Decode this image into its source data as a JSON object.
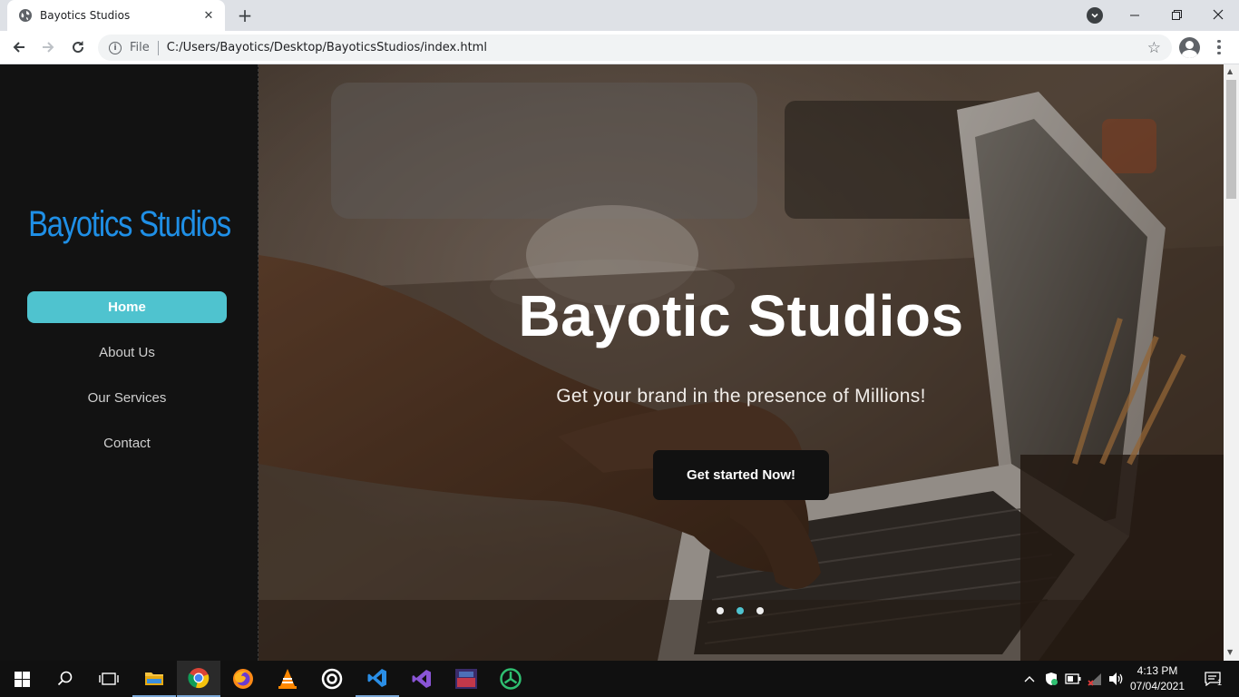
{
  "browser": {
    "tab_title": "Bayotics Studios",
    "scheme_label": "File",
    "url": "C:/Users/Bayotics/Desktop/BayoticsStudios/index.html"
  },
  "sidebar": {
    "logo": "Bayotics Studios",
    "nav": [
      {
        "label": "Home",
        "active": true
      },
      {
        "label": "About Us"
      },
      {
        "label": "Our Services"
      },
      {
        "label": "Contact"
      }
    ]
  },
  "hero": {
    "title": "Bayotic Studios",
    "subtitle": "Get your brand in the presence of Millions!",
    "cta_label": "Get started Now!",
    "carousel": {
      "slides": 3,
      "active_index": 1
    }
  },
  "taskbar": {
    "apps": [
      "windows-start",
      "search",
      "task-view",
      "file-explorer",
      "chrome",
      "firefox",
      "vlc",
      "media-app",
      "vscode",
      "visual-studio",
      "game-app",
      "green-app"
    ],
    "time": "4:13 PM",
    "date": "07/04/2021",
    "notification_count": "1"
  },
  "colors": {
    "accent": "#4fc3cf",
    "logo": "#1f8fe6",
    "sidebar_bg": "#121212"
  }
}
